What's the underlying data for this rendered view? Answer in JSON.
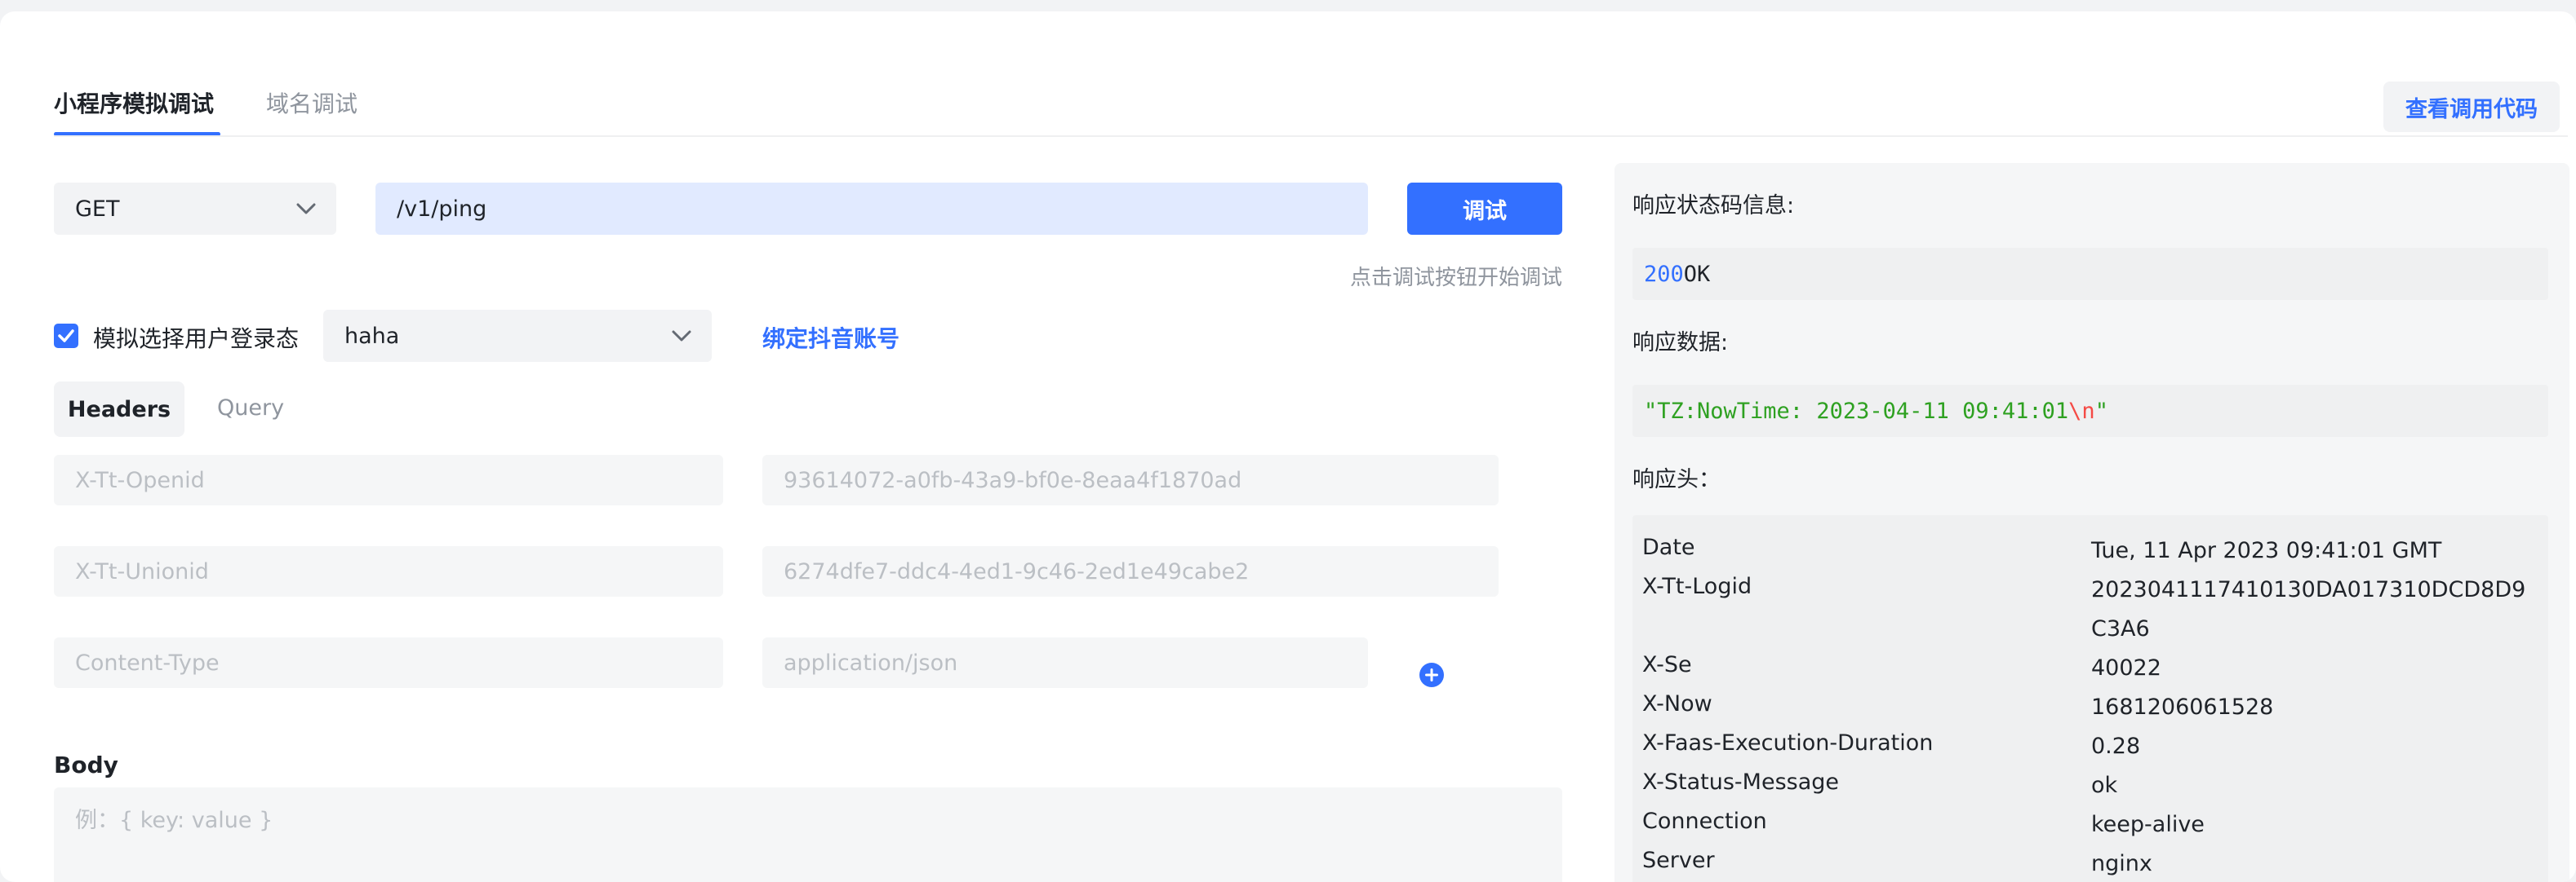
{
  "tabs": [
    {
      "label": "小程序模拟调试",
      "active": true
    },
    {
      "label": "域名调试",
      "active": false
    }
  ],
  "view_code_button": "查看调用代码",
  "request": {
    "method": "GET",
    "url": "/v1/ping",
    "debug_button": "调试",
    "hint": "点击调试按钮开始调试"
  },
  "login": {
    "checked": true,
    "label": "模拟选择用户登录态",
    "user": "haha",
    "bind_link": "绑定抖音账号"
  },
  "subtabs": [
    {
      "label": "Headers",
      "active": true
    },
    {
      "label": "Query",
      "active": false
    }
  ],
  "headers": [
    {
      "key": "X-Tt-Openid",
      "value": "93614072-a0fb-43a9-bf0e-8eaa4f1870ad"
    },
    {
      "key": "X-Tt-Unionid",
      "value": "6274dfe7-ddc4-4ed1-9c46-2ed1e49cabe2"
    },
    {
      "key": "Content-Type",
      "value": "application/json"
    }
  ],
  "body": {
    "label": "Body",
    "placeholder": "例：{ key: value }"
  },
  "response": {
    "status_label": "响应状态码信息:",
    "status_code": "200",
    "status_text": "OK",
    "data_label": "响应数据:",
    "data_prefix": "\"TZ:NowTime: 2023-04-11 09:41:01",
    "data_escape": "\\n",
    "data_suffix": "\"",
    "headers_label": "响应头：",
    "headers": [
      {
        "key": "Date",
        "value": "Tue, 11 Apr 2023 09:41:01 GMT"
      },
      {
        "key": "X-Tt-Logid",
        "value": "2023041117410130DA017310DCD8D9C3A6"
      },
      {
        "key": "X-Se",
        "value": "40022"
      },
      {
        "key": "X-Now",
        "value": "1681206061528"
      },
      {
        "key": "X-Faas-Execution-Duration",
        "value": "0.28"
      },
      {
        "key": "X-Status-Message",
        "value": "ok"
      },
      {
        "key": "Connection",
        "value": "keep-alive"
      },
      {
        "key": "Server",
        "value": "nginx"
      }
    ]
  },
  "colors": {
    "primary": "#3370ff",
    "number": "#3370ff",
    "string": "#2ea121",
    "escape": "#f54a45"
  }
}
